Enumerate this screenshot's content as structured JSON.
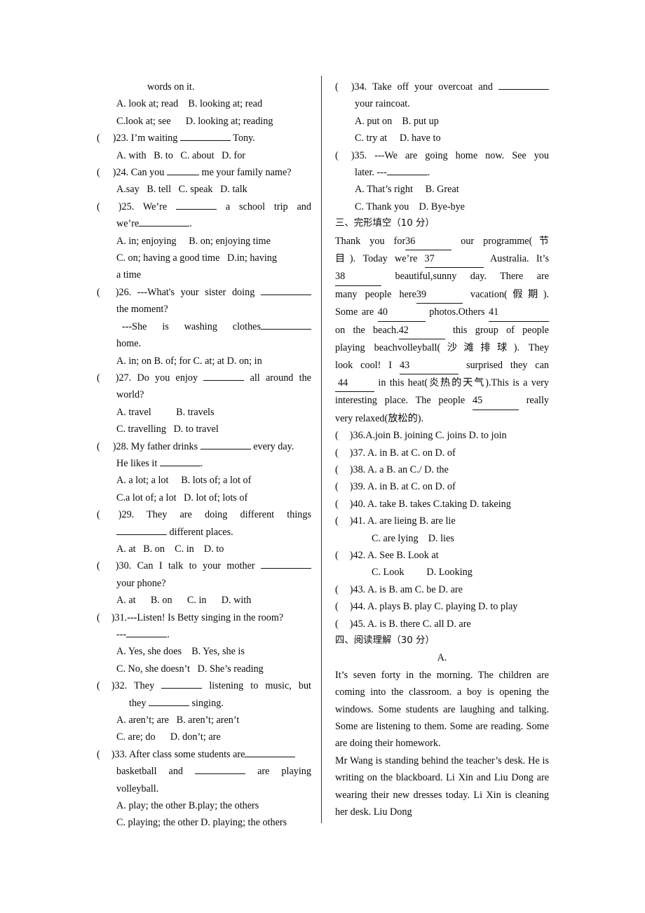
{
  "document": {
    "type": "english-exam-worksheet",
    "background_color": "#ffffff",
    "text_color": "#0a0a0a",
    "divider_color": "#3a3a3a"
  },
  "left_column": {
    "q22_continuation": {
      "stem_tail": "words on it.",
      "options_line1": "A. look at; read    B. looking at; read",
      "options_line2": "C.look at; see      D. looking at; reading"
    },
    "q23": {
      "marker_open": "(",
      "marker_close": ")",
      "stem_pre": "23. I’m waiting ",
      "stem_post": " Tony.",
      "options": "A. with   B. to   C. about   D. for"
    },
    "q24": {
      "marker_open": "(",
      "marker_close": ")",
      "stem_pre": "24. Can you ",
      "stem_post": " me your family name?",
      "options": "A.say   B. tell   C. speak   D. talk"
    },
    "q25": {
      "marker_open": "(",
      "marker_close": ")",
      "stem_pre": "25. We’re ",
      "stem_post": " a school trip and",
      "stem_line2_pre": "we’re",
      "stem_line2_post": ".",
      "options_line1": "A. in; enjoying     B. on; enjoying time",
      "options_line2": "C. on; having a good time   D.in; having",
      "options_line3": "a time"
    },
    "q26": {
      "marker_open": "(",
      "marker_close": ")",
      "stem_pre": "26. ---What's your sister doing ",
      "stem_line2": "the moment?",
      "stem_line3_pre": "---She is washing clothes",
      "stem_line4": "home.",
      "options": "A. in; on B. of; for C. at; at D. on; in"
    },
    "q27": {
      "marker_open": "(",
      "marker_close": ")",
      "stem_pre": "27. Do you enjoy ",
      "stem_post": " all around the",
      "stem_line2": "world?",
      "options_line1": "A. travel          B. travels",
      "options_line2": "C. travelling   D. to travel"
    },
    "q28": {
      "marker_open": "(",
      "marker_close": ")",
      "stem_pre": "28. My father drinks ",
      "stem_post": " every day.",
      "stem_line2_pre": "He likes it ",
      "stem_line2_post": ".",
      "options_line1": "A. a lot; a lot     B. lots of; a lot of",
      "options_line2": "C.a lot of; a lot   D. lot of; lots of"
    },
    "q29": {
      "marker_open": "(",
      "marker_close": ")",
      "stem": "29. They are doing different things",
      "stem_line2_post": " different places.",
      "options": "A. at   B. on    C. in    D. to"
    },
    "q30": {
      "marker_open": "(",
      "marker_close": ")",
      "stem_pre": "30. Can I talk to your mother ",
      "stem_line2": "your phone?",
      "options": "A. at      B. on      C. in      D. with"
    },
    "q31": {
      "marker_open": "(",
      "marker_close": ")",
      "stem": "31.---Listen! Is Betty singing in the room?",
      "stem_line2_pre": "---",
      "stem_line2_post": ".",
      "options_line1": "A. Yes, she does    B. Yes, she is",
      "options_line2": "C. No, she doesn’t   D. She’s reading"
    },
    "q32": {
      "marker_open": "(",
      "marker_close": ")",
      "stem_pre": "32. They ",
      "stem_post": " listening to music, but",
      "stem_line2_pre": "they ",
      "stem_line2_post": " singing.",
      "options_line1": "A. aren’t; are   B. aren’t; aren’t",
      "options_line2": "C. are; do      D. don’t; are"
    },
    "q33": {
      "marker_open": "(",
      "marker_close": ")",
      "stem_pre": "33. After class some students are",
      "stem_line2_pre": "basketball and ",
      "stem_line2_post": " are playing",
      "stem_line3": "volleyball.",
      "options_line1": "A. play; the other B.play; the others",
      "options_line2": "C. playing; the other D. playing; the others"
    }
  },
  "right_column": {
    "q34": {
      "marker_open": "(",
      "marker_close": ")",
      "stem_pre": "34. Take off your overcoat and ",
      "stem_line2": "your raincoat.",
      "options_line1": "A. put on    B. put up",
      "options_line2": "C. try at     D. have to"
    },
    "q35": {
      "marker_open": "(",
      "marker_close": ")",
      "stem": "35. ---We are going home now. See you",
      "stem_line2_pre": "later. ---",
      "stem_line2_post": ".",
      "options_line1": "A. That’s right     B. Great",
      "options_line2": "C. Thank you    D. Bye-bye"
    },
    "section3": {
      "heading": "三、完形填空（10 分）",
      "passage": {
        "l1_pre": "Thank you for",
        "l1_blank": "36",
        "l1_post": " our programme(节",
        "l2_pre": "目). Today we’re ",
        "l2_blank": "37",
        "l2_post": " Australia. It’s",
        "l3_blank": "38",
        "l3_post": " beautiful,sunny day. There are",
        "l4_pre": "many people here",
        "l4_blank": "39",
        "l4_post": " vacation(假期).",
        "l5_pre": "Some are ",
        "l5_blank": "40",
        "l5_mid": " photos.Others ",
        "l5_blank2": "41",
        "l6_pre": "on the beach.",
        "l6_blank": "42",
        "l6_post": " this group of people",
        "l7": "playing beachvolleyball(沙滩排球). They",
        "l8_pre": "look cool! I ",
        "l8_blank": "43",
        "l8_post": " surprised they can",
        "l9_blank": "44",
        "l9_post": " in this heat(炎热的天气).This is a very",
        "l10_pre": "interesting place. The people ",
        "l10_blank": "45",
        "l10_post": " really",
        "l11": "very relaxed(放松的)."
      },
      "options": [
        {
          "marker_open": "(",
          "marker_close": ")",
          "text": "36.A.join   B. joining C. joins D. to join"
        },
        {
          "marker_open": "(",
          "marker_close": ")",
          "text": "37. A. in     B. at      C. on     D. of"
        },
        {
          "marker_open": "(",
          "marker_close": ")",
          "text": "38. A. a     B. an      C./       D. the"
        },
        {
          "marker_open": "(",
          "marker_close": ")",
          "text": "39. A. in     B. at      C. on     D. of"
        },
        {
          "marker_open": "(",
          "marker_close": ")",
          "text": "40. A. take B. takes   C.taking D. takeing"
        },
        {
          "marker_open": "(",
          "marker_close": ")",
          "text": "41. A. are lieing    B. are lie",
          "text2": "C. are lying    D. lies"
        },
        {
          "marker_open": "(",
          "marker_close": ")",
          "text": "42. A. See            B. Look at",
          "text2": "C. Look         D. Looking"
        },
        {
          "marker_open": "(",
          "marker_close": ")",
          "text": "43. A. is   B. am    C. be       D. are"
        },
        {
          "marker_open": "(",
          "marker_close": ")",
          "text": "44. A. plays B. play C. playing D. to play"
        },
        {
          "marker_open": "(",
          "marker_close": ")",
          "text": "45. A. is    B. there  C. all    D. are"
        }
      ]
    },
    "section4": {
      "heading": "四、阅读理解（30 分）",
      "part_label": "A.",
      "para1": "It’s seven forty in the morning. The children are coming into the classroom. a boy is opening the windows. Some students are laughing and talking. Some are listening to them. Some are reading. Some are doing their homework.",
      "para2": "Mr Wang is standing behind the teacher’s desk. He is writing on the blackboard. Li Xin and Liu Dong are wearing their new dresses today. Li Xin is cleaning her desk. Liu Dong"
    }
  }
}
